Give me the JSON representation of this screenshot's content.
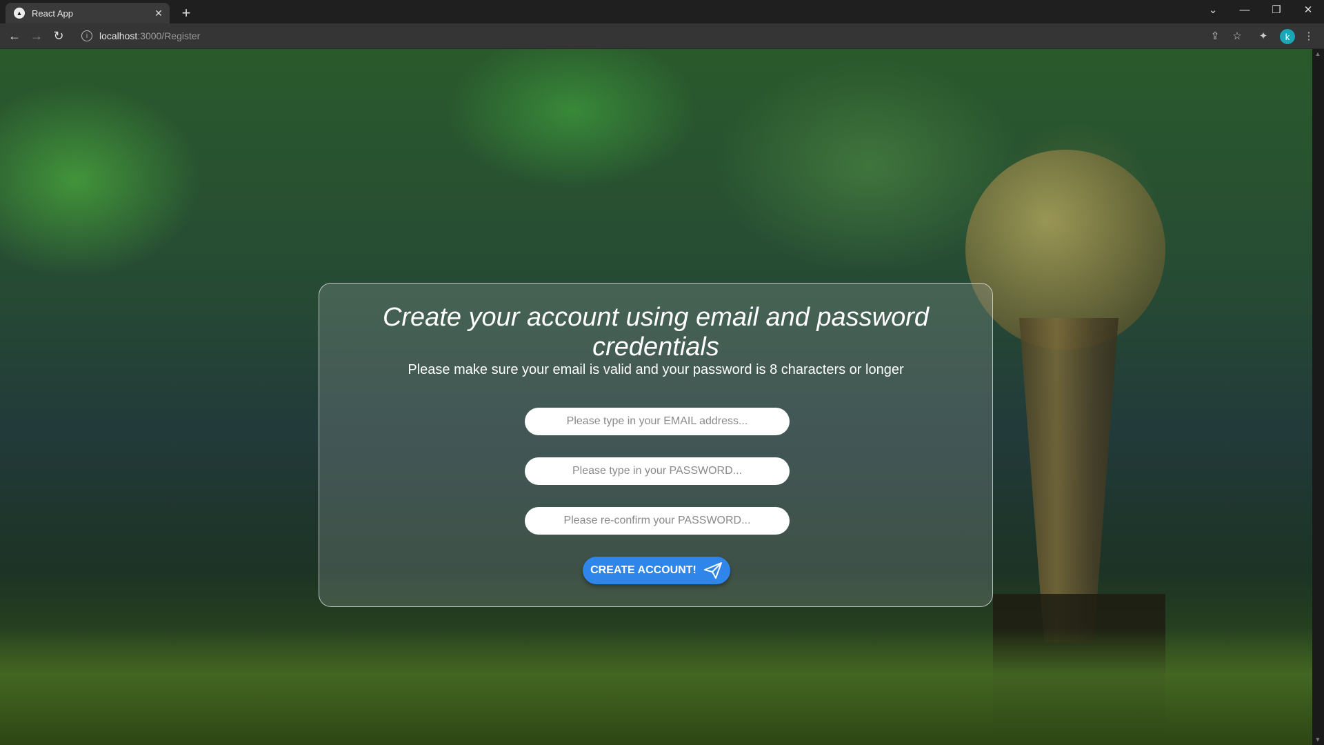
{
  "browser": {
    "tab_title": "React App",
    "url_host": "localhost",
    "url_path": ":3000/Register",
    "profile_initial": "k"
  },
  "page": {
    "heading": "Create your account using email and password credentials",
    "subheading": "Please make sure your email is valid and your password is 8 characters or longer",
    "email_placeholder": "Please type in your EMAIL address...",
    "password_placeholder": "Please type in your PASSWORD...",
    "confirm_placeholder": "Please re-confirm your PASSWORD...",
    "submit_label": "CREATE ACCOUNT!",
    "submit_icon": "paper-plane-icon",
    "accent_color": "#2f86ea"
  }
}
